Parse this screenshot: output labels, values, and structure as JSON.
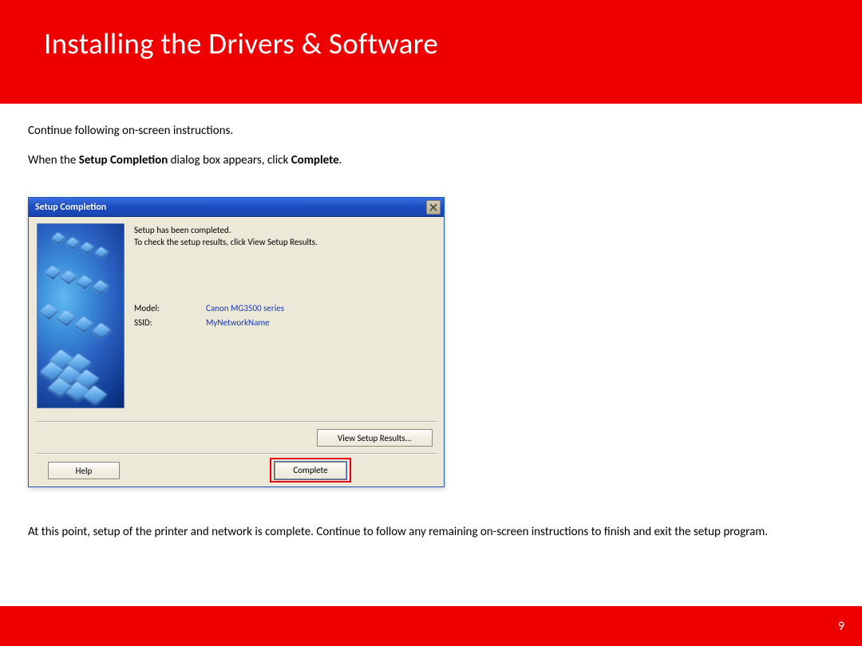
{
  "slide": {
    "title": "Installing  the Drivers & Software",
    "page_number": "9"
  },
  "instructions": {
    "line1": "Continue following on-screen instructions.",
    "line2_pre": "When the  ",
    "line2_b1": "Setup Completion",
    "line2_mid": " dialog box appears, click ",
    "line2_b2": "Complete",
    "line2_post": "."
  },
  "dialog": {
    "title": "Setup Completion",
    "msg_l1": "Setup has been completed.",
    "msg_l2": "To check the setup results, click View Setup Results.",
    "model_label": "Model:",
    "model_value": "Canon MG3500 series",
    "ssid_label": "SSID:",
    "ssid_value": "MyNetworkName",
    "btn_view": "View Setup Results...",
    "btn_help": "Help",
    "btn_complete": "Complete"
  },
  "closing": {
    "text": "At this point, setup of the printer and network is complete.  Continue to follow any remaining on-screen instructions to finish and exit the setup program."
  }
}
